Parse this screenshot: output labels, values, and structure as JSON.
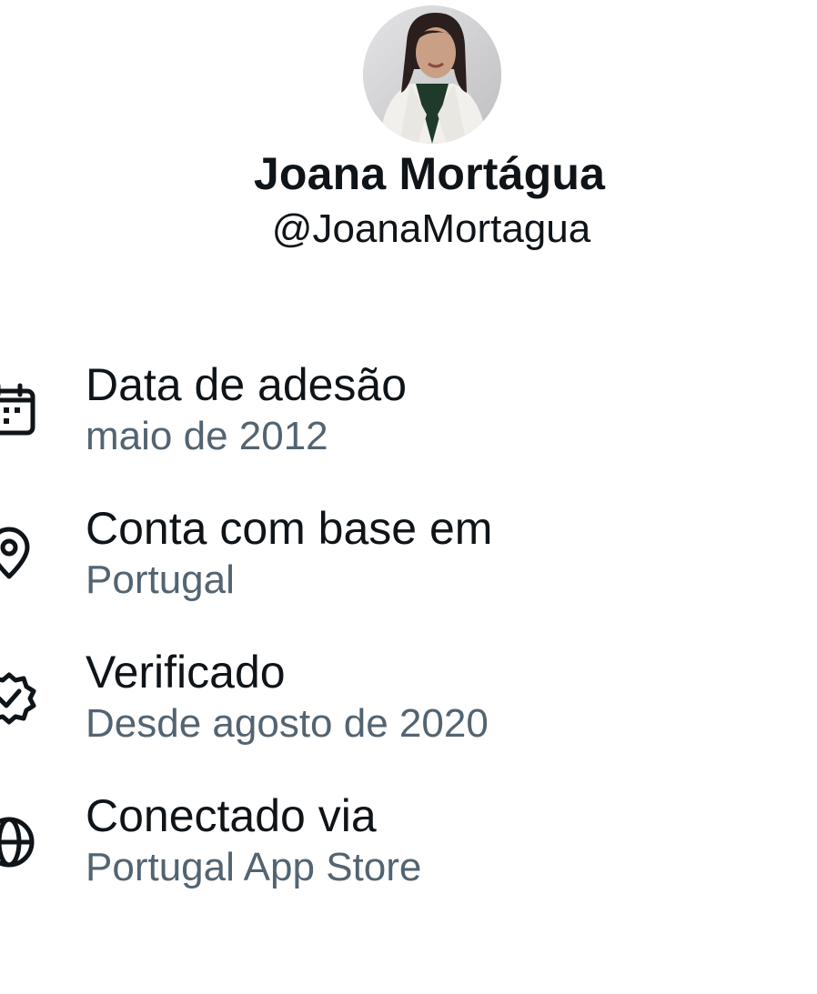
{
  "profile": {
    "display_name": "Joana Mortágua",
    "handle": "@JoanaMortagua"
  },
  "about": {
    "items": [
      {
        "icon": "calendar-icon",
        "title": "Data de adesão",
        "value": "maio de 2012"
      },
      {
        "icon": "location-pin-icon",
        "title": "Conta com base em",
        "value": "Portugal"
      },
      {
        "icon": "verified-badge-icon",
        "title": "Verificado",
        "value": "Desde agosto de 2020"
      },
      {
        "icon": "globe-icon",
        "title": "Conectado via",
        "value": "Portugal App Store"
      }
    ]
  },
  "colors": {
    "primary_text": "#0f1419",
    "secondary_text": "#536471"
  }
}
